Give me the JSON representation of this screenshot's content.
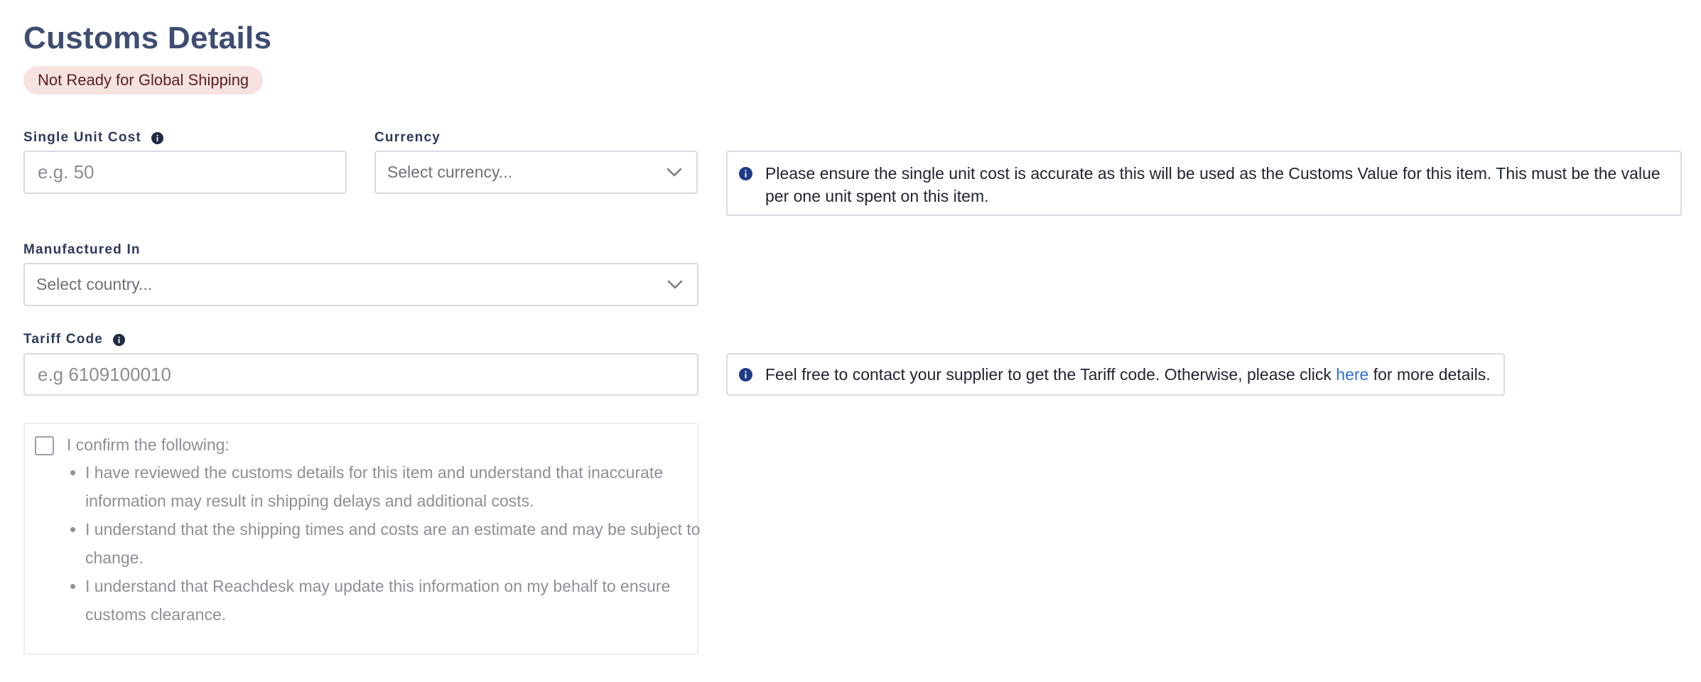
{
  "header": {
    "title": "Customs Details",
    "status_badge": "Not Ready for Global Shipping"
  },
  "fields": {
    "unit_cost": {
      "label": "Single Unit Cost",
      "placeholder": "e.g. 50",
      "value": ""
    },
    "currency": {
      "label": "Currency",
      "placeholder": "Select currency..."
    },
    "manufactured_in": {
      "label": "Manufactured In",
      "placeholder": "Select country..."
    },
    "tariff_code": {
      "label": "Tariff Code",
      "placeholder": "e.g 6109100010",
      "value": ""
    }
  },
  "notices": {
    "unit_cost": "Please ensure the single unit cost is accurate as this will be used as the Customs Value for this item. This must be the value per one unit spent on this item.",
    "tariff_before": "Feel free to contact your supplier to get the Tariff code. Otherwise, please click",
    "tariff_link": "here",
    "tariff_after": "for more details."
  },
  "confirmation": {
    "checked": false,
    "lead": "I confirm the following:",
    "items": [
      "I have reviewed the customs details for this item and understand that inaccurate information may result in shipping delays and additional costs.",
      "I understand that the shipping times and costs are an estimate and may be subject to change.",
      "I understand that Reachdesk may update this information on my behalf to ensure customs clearance."
    ]
  },
  "colors": {
    "title": "#3f4d72",
    "badge_bg": "#f7e2e2",
    "badge_text": "#5a1f1f",
    "info_icon": "#1e3a86",
    "link": "#2f6fd6",
    "border": "#d8dbe3"
  },
  "icons": {
    "label_info": "info-icon",
    "select_chevron": "chevron-down-icon",
    "notice_info": "info-icon"
  }
}
